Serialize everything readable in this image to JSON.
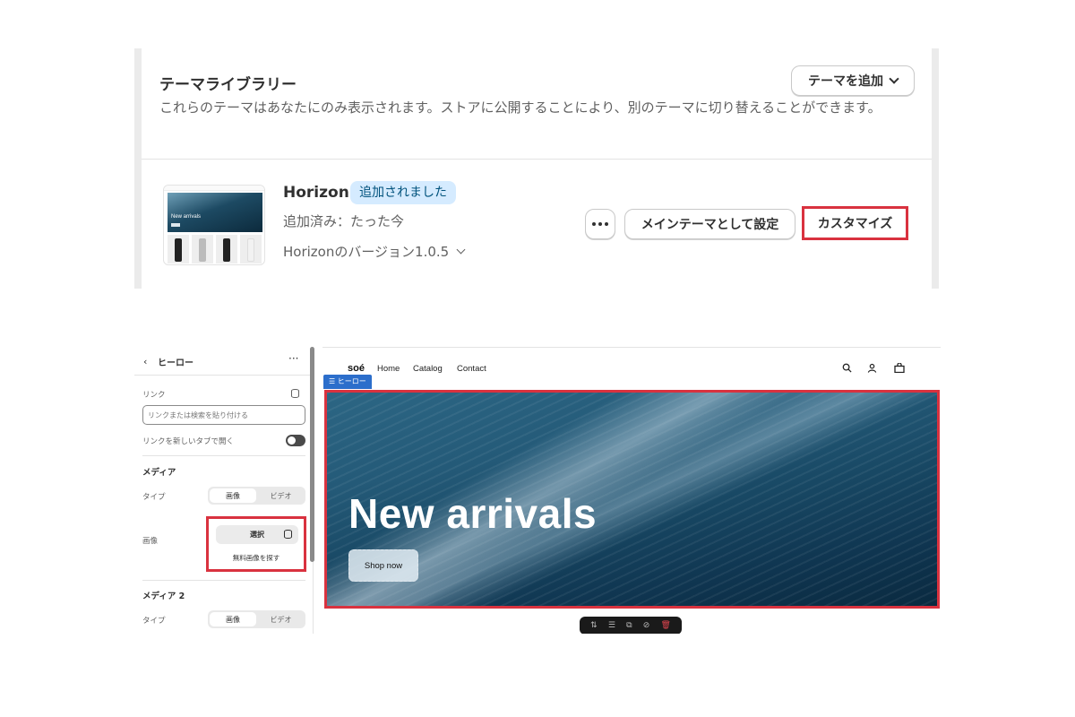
{
  "library": {
    "title": "テーマライブラリー",
    "description": "これらのテーマはあなたにのみ表示されます。ストアに公開することにより、別のテーマに切り替えることができます。",
    "add_theme_label": "テーマを追加"
  },
  "theme": {
    "thumbnail_hero_text": "New arrivals",
    "name": "Horizon",
    "badge": "追加されました",
    "added_at": "追加済み：たった今",
    "version": "Horizonのバージョン1.0.5",
    "more_label": "•••",
    "set_main_label": "メインテーマとして設定",
    "customize_label": "カスタマイズ"
  },
  "sidebar": {
    "back_glyph": "‹",
    "title": "ヒーロー",
    "menu_glyph": "···",
    "link_label": "リンク",
    "link_placeholder": "リンクまたは検索を貼り付ける",
    "new_tab_label": "リンクを新しいタブで開く",
    "media_heading": "メディア",
    "type_label": "タイプ",
    "type_image": "画像",
    "type_video": "ビデオ",
    "image_label": "画像",
    "select_label": "選択",
    "free_images_label": "無料画像を探す",
    "media2_heading": "メディア 2",
    "type2_label": "タイプ",
    "type2_image": "画像",
    "type2_video": "ビデオ"
  },
  "preview": {
    "logo": "soé",
    "nav": [
      "Home",
      "Catalog",
      "Contact"
    ],
    "section_tag": "☰ ヒーロー",
    "hero_title": "New arrivals",
    "hero_button": "Shop now",
    "icons": [
      "search-icon",
      "account-icon",
      "cart-icon"
    ]
  },
  "colors": {
    "highlight": "#d9323f",
    "badge_bg": "#d5ebff",
    "section_tag": "#2c6ecb"
  }
}
